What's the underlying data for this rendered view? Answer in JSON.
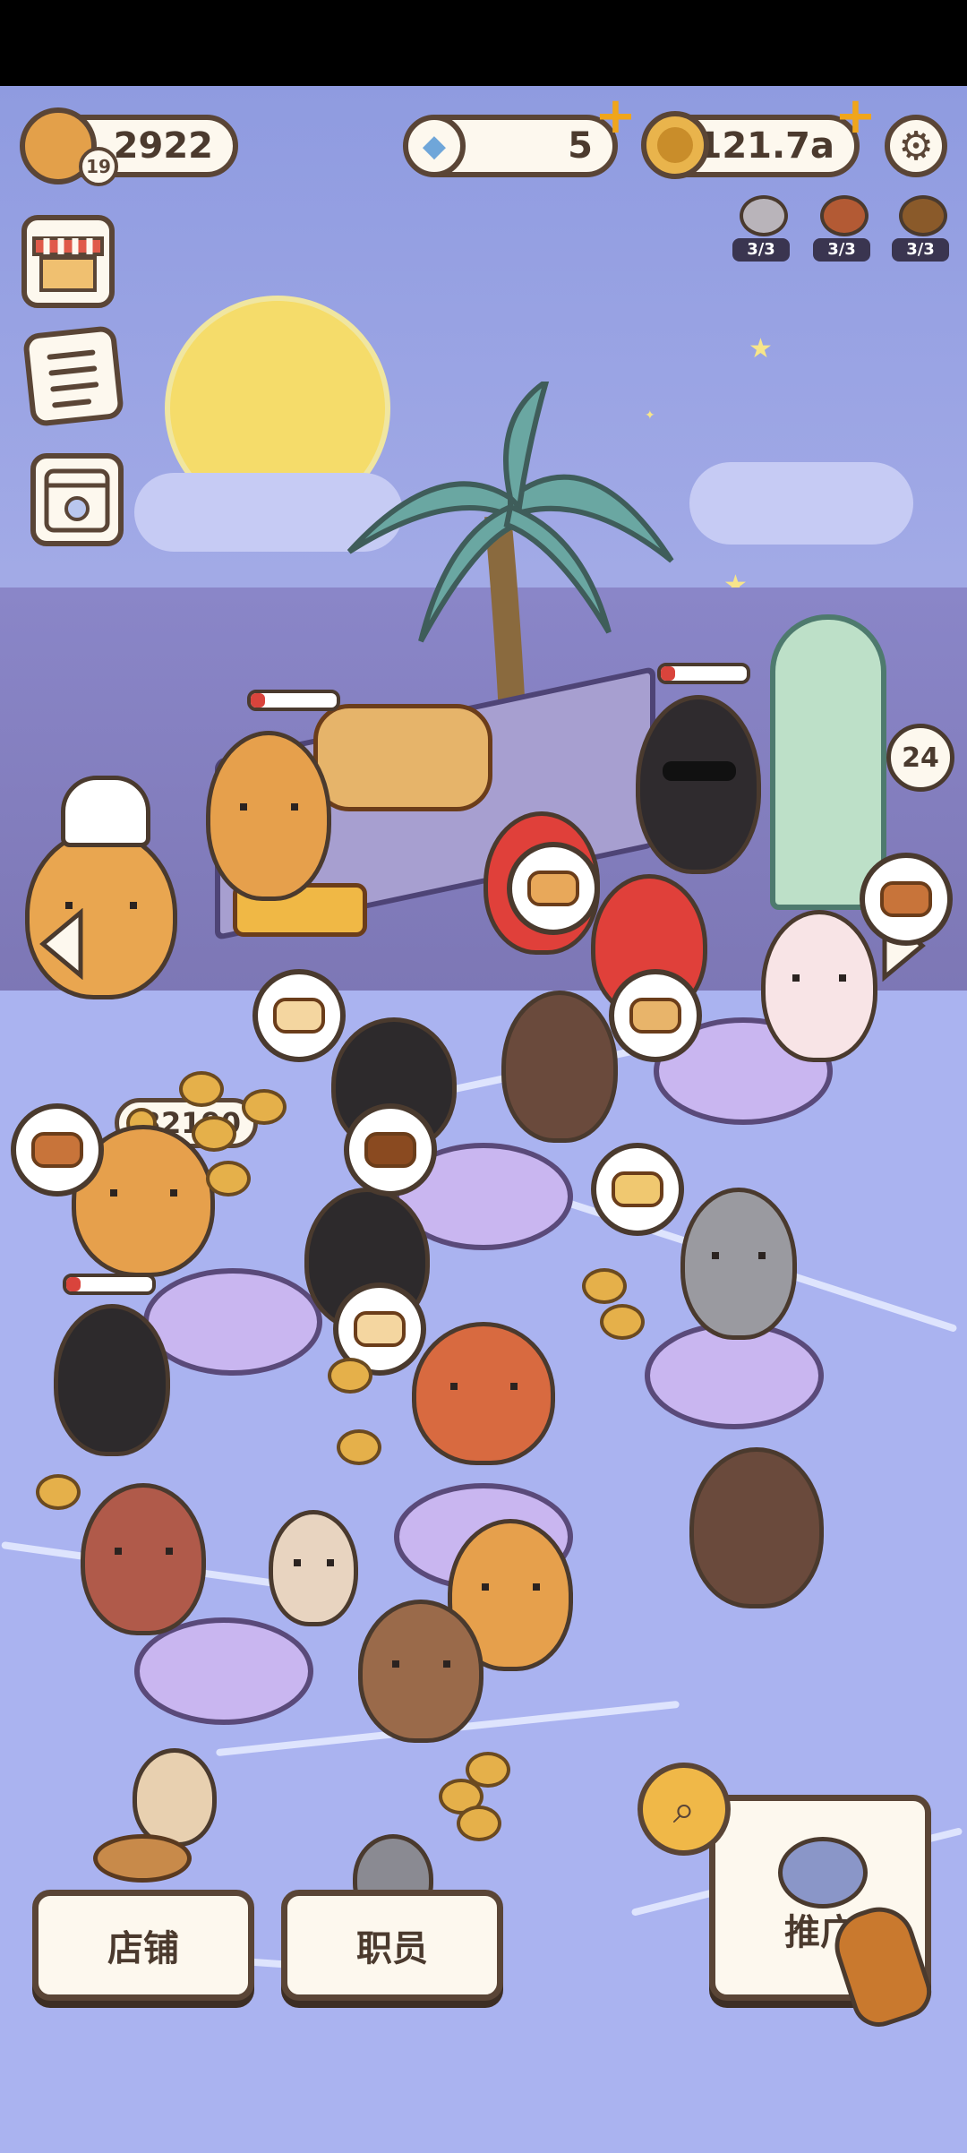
{
  "header": {
    "bread": {
      "value": "2922",
      "level": "19",
      "icon": "bread-icon"
    },
    "gems": {
      "value": "5",
      "icon": "diamond-icon"
    },
    "coins": {
      "value": "121.7a",
      "icon": "coin-icon"
    },
    "settings_icon": "gear-icon"
  },
  "boosts": [
    {
      "count": "3/3",
      "color": "#b9b4ba"
    },
    {
      "count": "3/3",
      "color": "#b35a34"
    },
    {
      "count": "3/3",
      "color": "#8a5a2a"
    }
  ],
  "side_menu": [
    "shop-stall-icon",
    "order-list-icon",
    "calendar-icon"
  ],
  "scene": {
    "money_counter": "32190",
    "waiting_count": "24"
  },
  "bottom_bar": {
    "shop_label": "店铺",
    "staff_label": "职员",
    "promo_label": "推广"
  },
  "colors": {
    "sky": "#8f9be0",
    "floor": "#aab3f0",
    "outline": "#5a4536",
    "cream": "#fdf8ee",
    "accent": "#f0a51b"
  }
}
